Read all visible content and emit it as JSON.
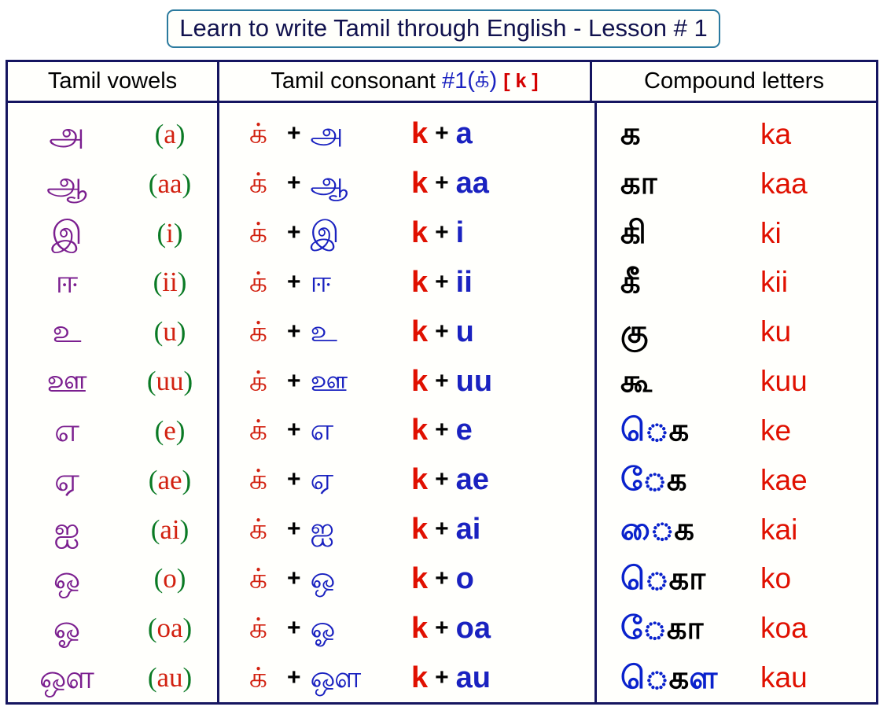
{
  "title": "Learn to write Tamil through English - Lesson # 1",
  "headers": {
    "vowels": "Tamil vowels",
    "consonant_label": "Tamil consonant",
    "consonant_number": "#1",
    "consonant_tamil": "(க்)",
    "consonant_latin": "[ k ]",
    "compound": "Compound letters"
  },
  "colors": {
    "title_text": "#11124e",
    "title_border": "#2b7a9e",
    "table_border": "#151560",
    "vowel_purple": "#7b1f8f",
    "paren_green": "#0a7a24",
    "translit_red": "#d22110",
    "blue": "#1a22c0",
    "red": "#e01000",
    "black": "#000000"
  },
  "plus_sign": "+",
  "vowels": [
    {
      "tamil": "அ",
      "open": "(",
      "translit": "a",
      "close": ")"
    },
    {
      "tamil": "ஆ",
      "open": "(",
      "translit": "aa",
      "close": ")"
    },
    {
      "tamil": "இ",
      "open": "(",
      "translit": "i",
      "close": ")"
    },
    {
      "tamil": "ஈ",
      "open": "(",
      "translit": "ii",
      "close": ")"
    },
    {
      "tamil": "உ",
      "open": "(",
      "translit": "u",
      "close": ")"
    },
    {
      "tamil": "ஊ",
      "open": "(",
      "translit": "uu",
      "close": ")"
    },
    {
      "tamil": "எ",
      "open": "(",
      "translit": "e",
      "close": ")"
    },
    {
      "tamil": "ஏ",
      "open": "(",
      "translit": "ae",
      "close": ")"
    },
    {
      "tamil": "ஐ",
      "open": "(",
      "translit": "ai",
      "close": ")"
    },
    {
      "tamil": "ஒ",
      "open": "(",
      "translit": "o",
      "close": ")"
    },
    {
      "tamil": "ஓ",
      "open": "(",
      "translit": "oa",
      "close": ")"
    },
    {
      "tamil": "ஔ",
      "open": "(",
      "translit": "au",
      "close": ")"
    }
  ],
  "consonant_rows": [
    {
      "k_tamil": "க்",
      "vowel_tamil": "அ",
      "k_latin": "k",
      "vowel_latin": "a"
    },
    {
      "k_tamil": "க்",
      "vowel_tamil": "ஆ",
      "k_latin": "k",
      "vowel_latin": "aa"
    },
    {
      "k_tamil": "க்",
      "vowel_tamil": "இ",
      "k_latin": "k",
      "vowel_latin": "i"
    },
    {
      "k_tamil": "க்",
      "vowel_tamil": "ஈ",
      "k_latin": "k",
      "vowel_latin": "ii"
    },
    {
      "k_tamil": "க்",
      "vowel_tamil": "உ",
      "k_latin": "k",
      "vowel_latin": "u"
    },
    {
      "k_tamil": "க்",
      "vowel_tamil": "ஊ",
      "k_latin": "k",
      "vowel_latin": "uu"
    },
    {
      "k_tamil": "க்",
      "vowel_tamil": "எ",
      "k_latin": "k",
      "vowel_latin": "e"
    },
    {
      "k_tamil": "க்",
      "vowel_tamil": "ஏ",
      "k_latin": "k",
      "vowel_latin": "ae"
    },
    {
      "k_tamil": "க்",
      "vowel_tamil": "ஐ",
      "k_latin": "k",
      "vowel_latin": "ai"
    },
    {
      "k_tamil": "க்",
      "vowel_tamil": "ஒ",
      "k_latin": "k",
      "vowel_latin": "o"
    },
    {
      "k_tamil": "க்",
      "vowel_tamil": "ஓ",
      "k_latin": "k",
      "vowel_latin": "oa"
    },
    {
      "k_tamil": "க்",
      "vowel_tamil": "ஔ",
      "k_latin": "k",
      "vowel_latin": "au"
    }
  ],
  "compound_rows": [
    {
      "pre": "",
      "base": "க",
      "post": "",
      "translit": "ka"
    },
    {
      "pre": "",
      "base": "க",
      "post": "ா",
      "translit": "kaa"
    },
    {
      "pre": "",
      "base": "க",
      "post": "ி",
      "translit": "ki"
    },
    {
      "pre": "",
      "base": "க",
      "post": "ீ",
      "translit": "kii"
    },
    {
      "pre": "",
      "base": "கு",
      "post": "",
      "translit": "ku"
    },
    {
      "pre": "",
      "base": "க",
      "post": "ூ",
      "translit": "kuu"
    },
    {
      "pre": "ெ",
      "base": "க",
      "post": "",
      "translit": "ke"
    },
    {
      "pre": "ே",
      "base": "க",
      "post": "",
      "translit": "kae"
    },
    {
      "pre": "ை",
      "base": "க",
      "post": "",
      "translit": "kai"
    },
    {
      "pre": "ெ",
      "base": "க",
      "post": "ா",
      "translit": "ko"
    },
    {
      "pre": "ே",
      "base": "க",
      "post": "ா",
      "translit": "koa"
    },
    {
      "pre": "ெ",
      "base": "க",
      "post": "ள",
      "translit": "kau"
    }
  ]
}
